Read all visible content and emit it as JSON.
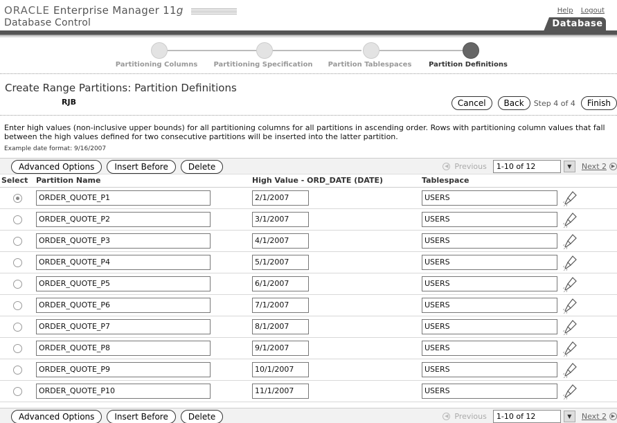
{
  "header": {
    "brand_oracle": "ORACLE",
    "brand_em": "Enterprise Manager 11",
    "brand_g": "g",
    "brand_sub": "Database Control",
    "help": "Help",
    "logout": "Logout",
    "tab": "Database"
  },
  "train": {
    "steps": [
      {
        "label": "Partitioning Columns",
        "current": false
      },
      {
        "label": "Partitioning Specification",
        "current": false
      },
      {
        "label": "Partition Tablespaces",
        "current": false
      },
      {
        "label": "Partition Definitions",
        "current": true
      }
    ]
  },
  "page": {
    "title": "Create Range Partitions: Partition Definitions",
    "subtitle": "RJB",
    "cancel": "Cancel",
    "back": "Back",
    "step_text": "Step 4 of 4",
    "finish": "Finish",
    "instructions": "Enter high values (non-inclusive upper bounds) for all partitioning columns for all partitions in ascending order. Rows with partitioning column values that fall between the high values defined for two consecutive partitions will be inserted into the latter partition.",
    "example": "Example date format: 9/16/2007"
  },
  "toolbar": {
    "advanced": "Advanced Options",
    "insert_before": "Insert Before",
    "delete": "Delete",
    "previous": "Previous",
    "range": "1-10 of 12",
    "next": "Next 2"
  },
  "table": {
    "columns": {
      "select": "Select",
      "name": "Partition Name",
      "high": "High Value - ORD_DATE (DATE)",
      "tablespace": "Tablespace"
    },
    "rows": [
      {
        "name": "ORDER_QUOTE_P1",
        "high": "2/1/2007",
        "ts": "USERS",
        "selected": true
      },
      {
        "name": "ORDER_QUOTE_P2",
        "high": "3/1/2007",
        "ts": "USERS",
        "selected": false
      },
      {
        "name": "ORDER_QUOTE_P3",
        "high": "4/1/2007",
        "ts": "USERS",
        "selected": false
      },
      {
        "name": "ORDER_QUOTE_P4",
        "high": "5/1/2007",
        "ts": "USERS",
        "selected": false
      },
      {
        "name": "ORDER_QUOTE_P5",
        "high": "6/1/2007",
        "ts": "USERS",
        "selected": false
      },
      {
        "name": "ORDER_QUOTE_P6",
        "high": "7/1/2007",
        "ts": "USERS",
        "selected": false
      },
      {
        "name": "ORDER_QUOTE_P7",
        "high": "8/1/2007",
        "ts": "USERS",
        "selected": false
      },
      {
        "name": "ORDER_QUOTE_P8",
        "high": "9/1/2007",
        "ts": "USERS",
        "selected": false
      },
      {
        "name": "ORDER_QUOTE_P9",
        "high": "10/1/2007",
        "ts": "USERS",
        "selected": false
      },
      {
        "name": "ORDER_QUOTE_P10",
        "high": "11/1/2007",
        "ts": "USERS",
        "selected": false
      }
    ]
  },
  "icons": {
    "flashlight": "flashlight-search-icon",
    "previous": "previous-arrow-icon",
    "next": "next-arrow-icon",
    "dropdown": "chevron-down-icon"
  },
  "colors": {
    "header_bar": "#555555",
    "train_current": "#666666",
    "train_inactive": "#e3e3e3"
  }
}
